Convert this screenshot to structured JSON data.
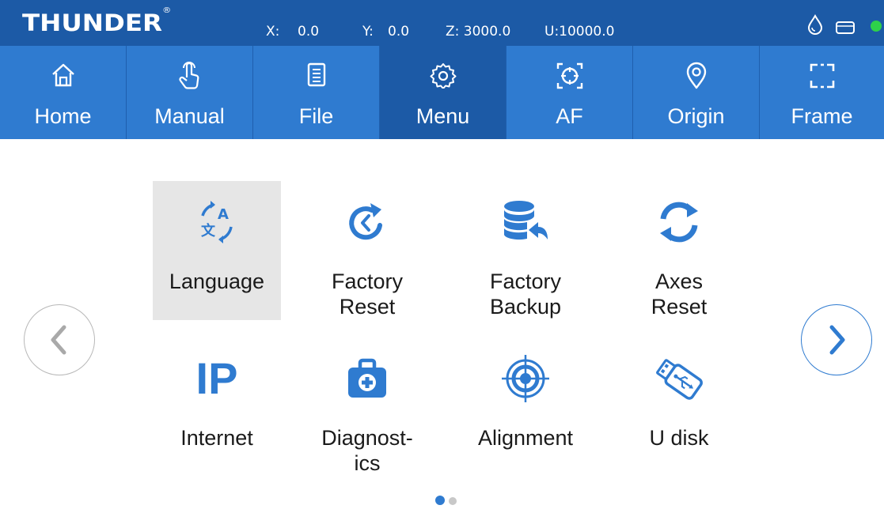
{
  "status_bar": {
    "brand": "THUNDER",
    "brand_mark": "®",
    "x_label": "X:",
    "x_value": "0.0",
    "y_label": "Y:",
    "y_value": "0.0",
    "z": "Z: 3000.0",
    "u": "U:10000.0",
    "icons": [
      "water-drop-icon",
      "card-icon",
      "connection-status-dot"
    ],
    "status_color": "#2ed14a"
  },
  "tabs": [
    {
      "label": "Home",
      "icon": "home-icon",
      "active": false
    },
    {
      "label": "Manual",
      "icon": "hand-pointer-icon",
      "active": false
    },
    {
      "label": "File",
      "icon": "file-icon",
      "active": false
    },
    {
      "label": "Menu",
      "icon": "gear-icon",
      "active": true
    },
    {
      "label": "AF",
      "icon": "target-focus-icon",
      "active": false
    },
    {
      "label": "Origin",
      "icon": "location-pin-icon",
      "active": false
    },
    {
      "label": "Frame",
      "icon": "frame-icon",
      "active": false
    }
  ],
  "menu_items": [
    {
      "label": "Language",
      "icon": "language-icon",
      "selected": true
    },
    {
      "label": "Factory\nReset",
      "icon": "factory-reset-icon",
      "selected": false
    },
    {
      "label": "Factory\nBackup",
      "icon": "database-backup-icon",
      "selected": false
    },
    {
      "label": "Axes\nReset",
      "icon": "refresh-icon",
      "selected": false
    },
    {
      "label": "Internet",
      "icon": "ip-icon",
      "icon_text": "IP",
      "selected": false
    },
    {
      "label": "Diagnost-\nics",
      "icon": "medical-kit-icon",
      "selected": false
    },
    {
      "label": "Alignment",
      "icon": "crosshair-icon",
      "selected": false
    },
    {
      "label": "U disk",
      "icon": "usb-drive-icon",
      "selected": false
    }
  ],
  "pager": {
    "current_page": 1,
    "total_pages": 2
  },
  "colors": {
    "status_bar": "#1c5aa6",
    "tab_bar": "#2f7bd0",
    "tab_active": "#1c5aa6",
    "accent": "#2f7bd0",
    "selected_bg": "#e6e6e6"
  }
}
